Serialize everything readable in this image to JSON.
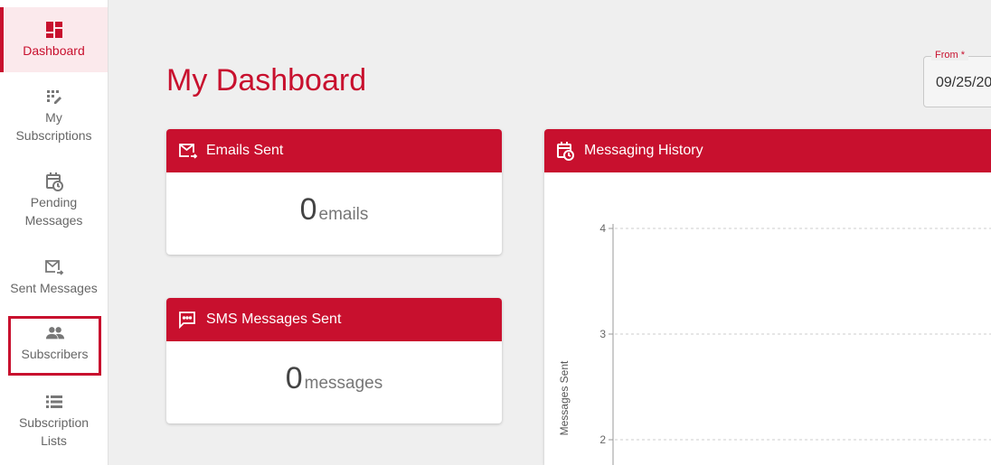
{
  "sidebar": {
    "items": [
      {
        "label": "Dashboard",
        "icon": "dashboard-icon"
      },
      {
        "label": "My Subscriptions",
        "icon": "edit-grid-icon"
      },
      {
        "label": "Pending Messages",
        "icon": "calendar-clock-icon"
      },
      {
        "label": "Sent Messages",
        "icon": "mail-forward-icon"
      },
      {
        "label": "Subscribers",
        "icon": "people-icon"
      },
      {
        "label": "Subscription Lists",
        "icon": "list-icon"
      }
    ]
  },
  "main": {
    "title": "My Dashboard",
    "date_from": {
      "label": "From *",
      "value": "09/25/20"
    }
  },
  "cards": {
    "emails": {
      "title": "Emails Sent",
      "count": "0",
      "unit": "emails"
    },
    "sms": {
      "title": "SMS Messages Sent",
      "count": "0",
      "unit": "messages"
    },
    "history": {
      "title": "Messaging History"
    }
  },
  "colors": {
    "accent": "#c8102e"
  },
  "chart_data": {
    "type": "line",
    "ylabel": "Messages Sent",
    "y_ticks": [
      "4",
      "3",
      "2"
    ],
    "grid": true
  }
}
